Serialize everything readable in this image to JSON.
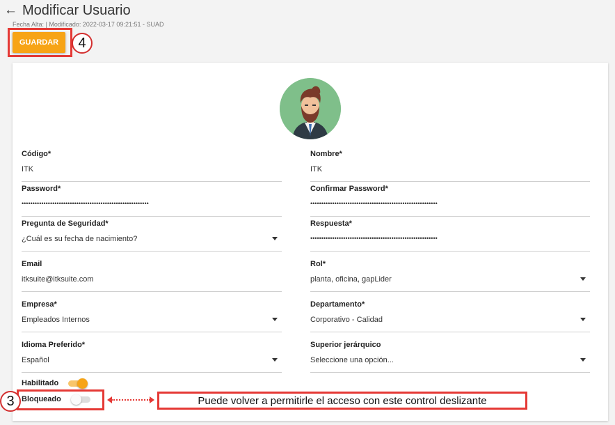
{
  "header": {
    "back_icon": "←",
    "title": "Modificar Usuario",
    "meta": "Fecha Alta: | Modificado: 2022-03-17 09:21:51 - SUAD"
  },
  "toolbar": {
    "save_label": "GUARDAR"
  },
  "annotations": {
    "badge_save": "4",
    "badge_blocked": "3",
    "note": "Puede volver a permitirle el acceso con este control deslizante",
    "accent": "#e53935"
  },
  "colors": {
    "primary": "#f7a416",
    "avatar_bg": "#7fbf8a"
  },
  "avatar": {
    "icon": "bearded-man-avatar-icon"
  },
  "form": {
    "codigo": {
      "label": "Código*",
      "value": "ITK"
    },
    "nombre": {
      "label": "Nombre*",
      "value": "ITK"
    },
    "password": {
      "label": "Password*",
      "value": "••••••••••••••••••••••••••••••••••••••••••••••••••••••••••"
    },
    "confirmar": {
      "label": "Confirmar Password*",
      "value": "••••••••••••••••••••••••••••••••••••••••••••••••••••••••••"
    },
    "pregunta": {
      "label": "Pregunta de Seguridad*",
      "value": "¿Cuál es su fecha de nacimiento?"
    },
    "respuesta": {
      "label": "Respuesta*",
      "value": "••••••••••••••••••••••••••••••••••••••••••••••••••••••••••"
    },
    "email": {
      "label": "Email",
      "value": "itksuite@itksuite.com"
    },
    "rol": {
      "label": "Rol*",
      "value": "planta, oficina, gapLider"
    },
    "empresa": {
      "label": "Empresa*",
      "value": "Empleados Internos"
    },
    "departamento": {
      "label": "Departamento*",
      "value": "Corporativo - Calidad"
    },
    "idioma": {
      "label": "Idioma Preferido*",
      "value": "Español"
    },
    "superior": {
      "label": "Superior jerárquico",
      "value": "Seleccione una opción..."
    }
  },
  "toggles": {
    "habilitado": {
      "label": "Habilitado",
      "on": true
    },
    "bloqueado": {
      "label": "Bloqueado",
      "on": false
    }
  }
}
